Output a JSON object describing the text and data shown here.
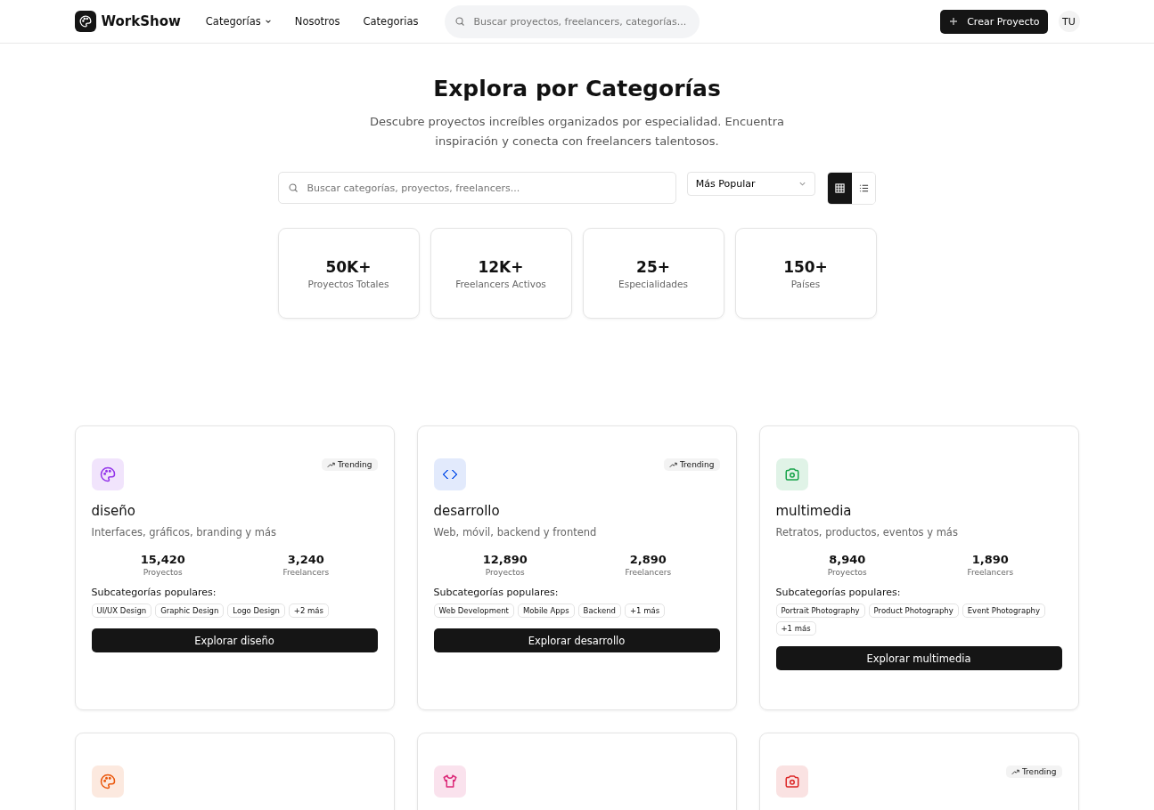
{
  "header": {
    "brand": "WorkShow",
    "nav": [
      {
        "label": "Categorías",
        "dropdown": true
      },
      {
        "label": "Nosotros",
        "dropdown": false
      },
      {
        "label": "Categorias",
        "dropdown": false
      }
    ],
    "search": {
      "placeholder": "Buscar proyectos, freelancers, categorías..."
    },
    "create_button": "Crear Proyecto",
    "avatar": "TU"
  },
  "hero": {
    "title": "Explora por Categorías",
    "subtitle": "Descubre proyectos increíbles organizados por especialidad. Encuentra inspiración y conecta con freelancers talentosos."
  },
  "toolbar": {
    "search": {
      "placeholder": "Buscar categorías, proyectos, freelancers..."
    },
    "sort": "Más Popular",
    "views": [
      {
        "kind": "grid",
        "selected": true
      },
      {
        "kind": "list",
        "selected": false
      }
    ]
  },
  "stats": [
    {
      "value": "50K+",
      "label": "Proyectos Totales"
    },
    {
      "value": "12K+",
      "label": "Freelancers Activos"
    },
    {
      "value": "25+",
      "label": "Especialidades"
    },
    {
      "value": "150+",
      "label": "Países"
    }
  ],
  "categories": [
    {
      "kind": "palette",
      "color": "#9333ea",
      "trending": "Trending",
      "title": "diseño",
      "description": "Interfaces, gráficos, branding y más",
      "projects": "15,420",
      "projects_label": "Proyectos",
      "freelancers": "3,240",
      "freelancers_label": "Freelancers",
      "subheading": "Subcategorías populares:",
      "tags": [
        "UI/UX Design",
        "Graphic Design",
        "Logo Design",
        "+2 más"
      ],
      "button": "Explorar diseño"
    },
    {
      "kind": "code",
      "color": "#2563eb",
      "trending": "Trending",
      "title": "desarrollo",
      "description": "Web, móvil, backend y frontend",
      "projects": "12,890",
      "projects_label": "Proyectos",
      "freelancers": "2,890",
      "freelancers_label": "Freelancers",
      "subheading": "Subcategorías populares:",
      "tags": [
        "Web Development",
        "Mobile Apps",
        "Backend",
        "+1 más"
      ],
      "button": "Explorar desarrollo"
    },
    {
      "kind": "camera",
      "color": "#16a34a",
      "title": "multimedia",
      "description": "Retratos, productos, eventos y más",
      "projects": "8,940",
      "projects_label": "Proyectos",
      "freelancers": "1,890",
      "freelancers_label": "Freelancers",
      "subheading": "Subcategorías populares:",
      "tags": [
        "Portrait Photography",
        "Product Photography",
        "Event Photography",
        "+1 más"
      ],
      "button": "Explorar multimedia"
    },
    {
      "kind": "palette",
      "color": "#ea580c"
    },
    {
      "kind": "shirt",
      "color": "#db2777"
    },
    {
      "kind": "camera",
      "color": "#dc2626",
      "trending": "Trending"
    }
  ]
}
